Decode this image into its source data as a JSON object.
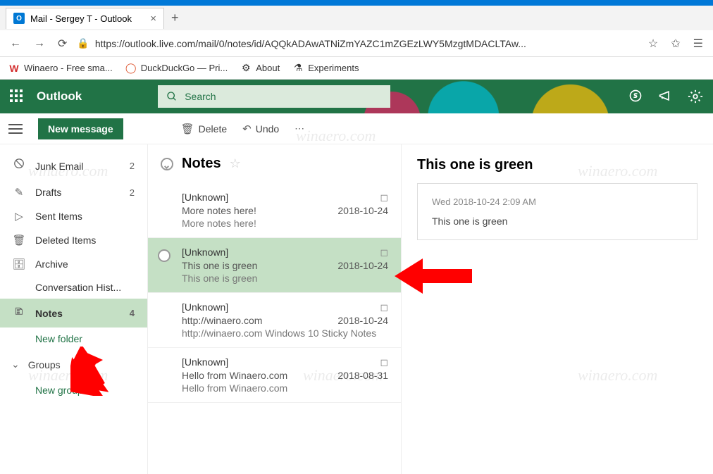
{
  "browser": {
    "tab_title": "Mail - Sergey T - Outlook",
    "url": "https://outlook.live.com/mail/0/notes/id/AQQkADAwATNiZmYAZC1mZGEzLWY5MzgtMDACLTAw...",
    "bookmarks": [
      {
        "label": "Winaero - Free sma...",
        "icon": "W"
      },
      {
        "label": "DuckDuckGo — Pri...",
        "icon": "🦆"
      },
      {
        "label": "About",
        "icon": "⚙"
      },
      {
        "label": "Experiments",
        "icon": "⚗"
      }
    ]
  },
  "header": {
    "brand": "Outlook",
    "search_placeholder": "Search"
  },
  "commands": {
    "new_message": "New message",
    "delete": "Delete",
    "undo": "Undo"
  },
  "sidebar": {
    "items": [
      {
        "icon": "🛇",
        "label": "Junk Email",
        "count": "2"
      },
      {
        "icon": "✎",
        "label": "Drafts",
        "count": "2"
      },
      {
        "icon": "▷",
        "label": "Sent Items",
        "count": ""
      },
      {
        "icon": "🗑",
        "label": "Deleted Items",
        "count": ""
      },
      {
        "icon": "🗄",
        "label": "Archive",
        "count": ""
      },
      {
        "icon": "",
        "label": "Conversation Hist...",
        "count": ""
      },
      {
        "icon": "🗈",
        "label": "Notes",
        "count": "4"
      }
    ],
    "new_folder": "New folder",
    "groups_label": "Groups",
    "new_group": "New group"
  },
  "list": {
    "title": "Notes",
    "items": [
      {
        "sender": "[Unknown]",
        "subject": "More notes here!",
        "preview": "More notes here!",
        "date": "2018-10-24"
      },
      {
        "sender": "[Unknown]",
        "subject": "This one is green",
        "preview": "This one is green",
        "date": "2018-10-24"
      },
      {
        "sender": "[Unknown]",
        "subject": "http://winaero.com",
        "preview": "http://winaero.com Windows 10 Sticky Notes",
        "date": "2018-10-24"
      },
      {
        "sender": "[Unknown]",
        "subject": "Hello from Winaero.com",
        "preview": "Hello from Winaero.com",
        "date": "2018-08-31"
      }
    ]
  },
  "reading": {
    "title": "This one is green",
    "date": "Wed 2018-10-24 2:09 AM",
    "body": "This one is green"
  },
  "watermark": "winaero.com"
}
